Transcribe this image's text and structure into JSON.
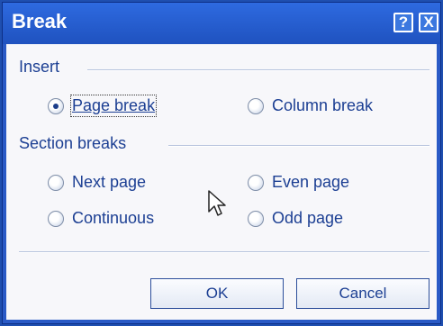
{
  "window": {
    "title": "Break",
    "help_label": "?",
    "close_label": "X"
  },
  "insert": {
    "label": "Insert",
    "options": [
      {
        "label": "Page break",
        "checked": true
      },
      {
        "label": "Column break",
        "checked": false
      }
    ]
  },
  "section_breaks": {
    "label": "Section breaks",
    "options": [
      {
        "label": "Next page",
        "checked": false
      },
      {
        "label": "Even page",
        "checked": false
      },
      {
        "label": "Continuous",
        "checked": false
      },
      {
        "label": "Odd page",
        "checked": false
      }
    ]
  },
  "buttons": {
    "ok": "OK",
    "cancel": "Cancel"
  }
}
